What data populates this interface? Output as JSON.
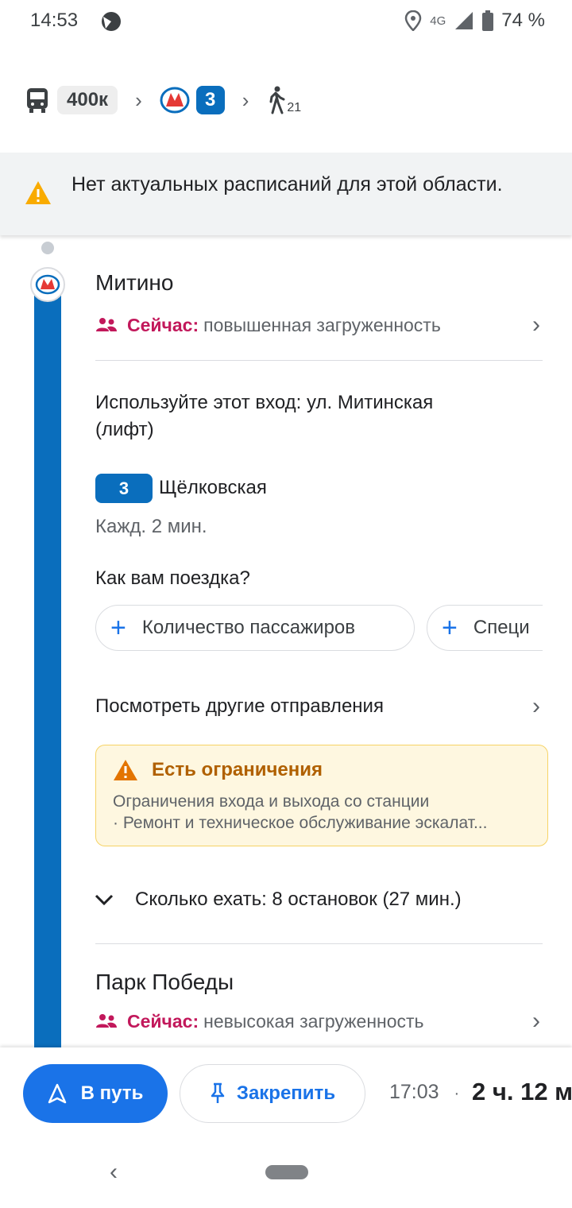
{
  "status": {
    "time": "14:53",
    "network": "4G",
    "battery": "74 %"
  },
  "route": {
    "bus_label": "400к",
    "metro_line": "3",
    "walk_minutes": "21"
  },
  "notice": {
    "text": "Нет актуальных расписаний для этой области."
  },
  "station_start": {
    "name": "Митино",
    "crowd_now": "Сейчас:",
    "crowd_level": "повышенная загруженность",
    "entrance_line1": "Используйте этот вход: ул. Митинская",
    "entrance_line2": "(лифт)",
    "line_number": "3",
    "direction": "Щёлковская",
    "frequency": "Кажд. 2 мин."
  },
  "feedback": {
    "question": "Как вам поездка?",
    "chips": [
      "Количество пассажиров",
      "Специ"
    ]
  },
  "other_departures": "Посмотреть другие отправления",
  "restrictions": {
    "title": "Есть ограничения",
    "line1": "Ограничения входа и выхода со станции",
    "line2": "· Ремонт и техническое обслуживание эскалат..."
  },
  "ride_summary": "Сколько ехать: 8 остановок (27 мин.)",
  "station_end": {
    "name": "Парк Победы",
    "crowd_now": "Сейчас:",
    "crowd_level": "невысокая загруженность"
  },
  "bottom": {
    "go_label": "В путь",
    "pin_label": "Закрепить",
    "arrival_time": "17:03",
    "separator": "·",
    "duration": "2 ч. 12 м"
  },
  "colors": {
    "metro_blue": "#0a6ebd",
    "crowd_pink": "#c2185b",
    "action_blue": "#1a73e8",
    "warning_orange": "#b06000"
  }
}
